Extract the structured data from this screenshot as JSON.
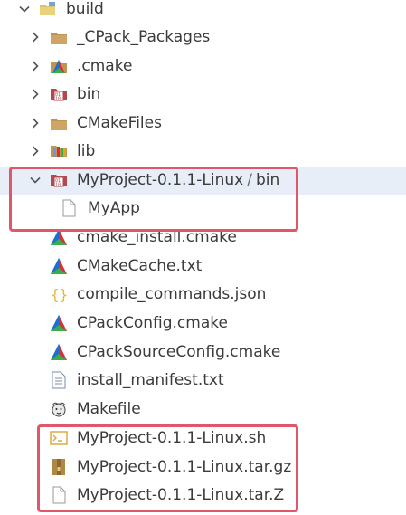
{
  "tree": {
    "root": {
      "label": "build",
      "expanded": true,
      "icon": "folder-build-icon"
    },
    "items": [
      {
        "label": "_CPack_Packages",
        "type": "folder",
        "expanded": false,
        "icon": "folder-icon"
      },
      {
        "label": ".cmake",
        "type": "folder",
        "expanded": false,
        "icon": "cmake-folder-icon"
      },
      {
        "label": "bin",
        "type": "folder",
        "expanded": false,
        "icon": "bin-folder-icon"
      },
      {
        "label": "CMakeFiles",
        "type": "folder",
        "expanded": false,
        "icon": "folder-icon"
      },
      {
        "label": "lib",
        "type": "folder",
        "expanded": false,
        "icon": "lib-folder-icon"
      },
      {
        "label": "MyProject-0.1.1-Linux",
        "label_sep": "/",
        "label_suffix": "bin",
        "type": "folder",
        "expanded": true,
        "icon": "bin-folder-open-icon"
      },
      {
        "label": "MyApp",
        "type": "file",
        "icon": "file-icon"
      },
      {
        "label": "cmake_install.cmake",
        "type": "file",
        "icon": "cmake-icon"
      },
      {
        "label": "CMakeCache.txt",
        "type": "file",
        "icon": "cmake-icon"
      },
      {
        "label": "compile_commands.json",
        "type": "file",
        "icon": "json-icon"
      },
      {
        "label": "CPackConfig.cmake",
        "type": "file",
        "icon": "cmake-icon"
      },
      {
        "label": "CPackSourceConfig.cmake",
        "type": "file",
        "icon": "cmake-icon"
      },
      {
        "label": "install_manifest.txt",
        "type": "file",
        "icon": "text-file-icon"
      },
      {
        "label": "Makefile",
        "type": "file",
        "icon": "gnu-makefile-icon"
      },
      {
        "label": "MyProject-0.1.1-Linux.sh",
        "type": "file",
        "icon": "shell-script-icon"
      },
      {
        "label": "MyProject-0.1.1-Linux.tar.gz",
        "type": "file",
        "icon": "archive-icon"
      },
      {
        "label": "MyProject-0.1.1-Linux.tar.Z",
        "type": "file",
        "icon": "file-icon"
      }
    ]
  },
  "colors": {
    "highlight_border": "#e0566a",
    "selection_bg": "#e8eef8",
    "folder": "#c09553",
    "cmake_red": "#d6303a",
    "cmake_blue": "#1f6fd0",
    "cmake_green": "#3cae49"
  }
}
